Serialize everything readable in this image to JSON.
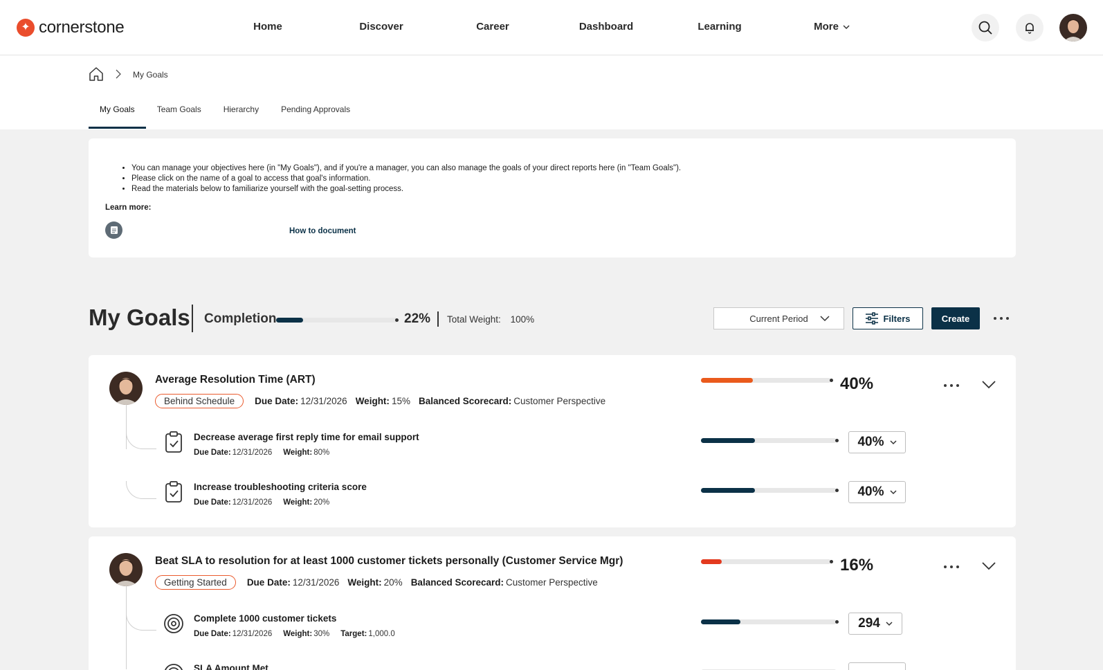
{
  "brand": {
    "name": "cornerstone",
    "accent": "#ea4d2c",
    "primary": "#0b3147"
  },
  "nav": {
    "items": [
      "Home",
      "Discover",
      "Career",
      "Dashboard",
      "Learning"
    ],
    "more_label": "More"
  },
  "breadcrumb": {
    "current": "My Goals"
  },
  "tabs": [
    "My Goals",
    "Team Goals",
    "Hierarchy",
    "Pending Approvals"
  ],
  "info": {
    "bullets": [
      "You can manage your objectives here (in \"My Goals\"), and if you're a manager, you can also manage the goals of your direct reports here (in \"Team Goals\").",
      "Please click on the name of a goal to access that goal's information.",
      "Read the materials below to familiarize yourself with the goal-setting process."
    ],
    "learn_more_label": "Learn more:",
    "doc_link": "How to document"
  },
  "summary": {
    "title": "My Goals",
    "completion_label": "Completion",
    "completion_pct": "22%",
    "completion_value": 0.22,
    "total_weight_label": "Total Weight:",
    "total_weight_value": "100%",
    "period": "Current Period",
    "filters_label": "Filters",
    "create_label": "Create"
  },
  "goals": [
    {
      "title": "Average Resolution Time (ART)",
      "status": "Behind Schedule",
      "due_label": "Due Date:",
      "due": "12/31/2026",
      "weight_label": "Weight:",
      "weight": "15%",
      "scorecard_label": "Balanced Scorecard:",
      "scorecard": "Customer Perspective",
      "pct": "40%",
      "progress": 0.4,
      "bar_color": "#ea5a1c",
      "subgoals": [
        {
          "icon": "clipboard-check-icon",
          "title": "Decrease average first reply time for email support",
          "due_label": "Due Date:",
          "due": "12/31/2026",
          "weight_label": "Weight:",
          "weight": "80%",
          "value": "40%",
          "progress": 0.4
        },
        {
          "icon": "clipboard-check-icon",
          "title": "Increase troubleshooting criteria score",
          "due_label": "Due Date:",
          "due": "12/31/2026",
          "weight_label": "Weight:",
          "weight": "20%",
          "value": "40%",
          "progress": 0.4
        }
      ]
    },
    {
      "title": "Beat SLA to resolution for at least 1000 customer tickets personally (Customer Service Mgr)",
      "status": "Getting Started",
      "due_label": "Due Date:",
      "due": "12/31/2026",
      "weight_label": "Weight:",
      "weight": "20%",
      "scorecard_label": "Balanced Scorecard:",
      "scorecard": "Customer Perspective",
      "pct": "16%",
      "progress": 0.16,
      "bar_color": "#e33a1f",
      "subgoals": [
        {
          "icon": "target-icon",
          "title": "Complete 1000 customer tickets",
          "due_label": "Due Date:",
          "due": "12/31/2026",
          "weight_label": "Weight:",
          "weight": "30%",
          "target_label": "Target:",
          "target": "1,000.0",
          "value": "294",
          "progress": 0.29
        },
        {
          "icon": "target-icon",
          "title": "SLA Amount Met"
        }
      ]
    }
  ]
}
